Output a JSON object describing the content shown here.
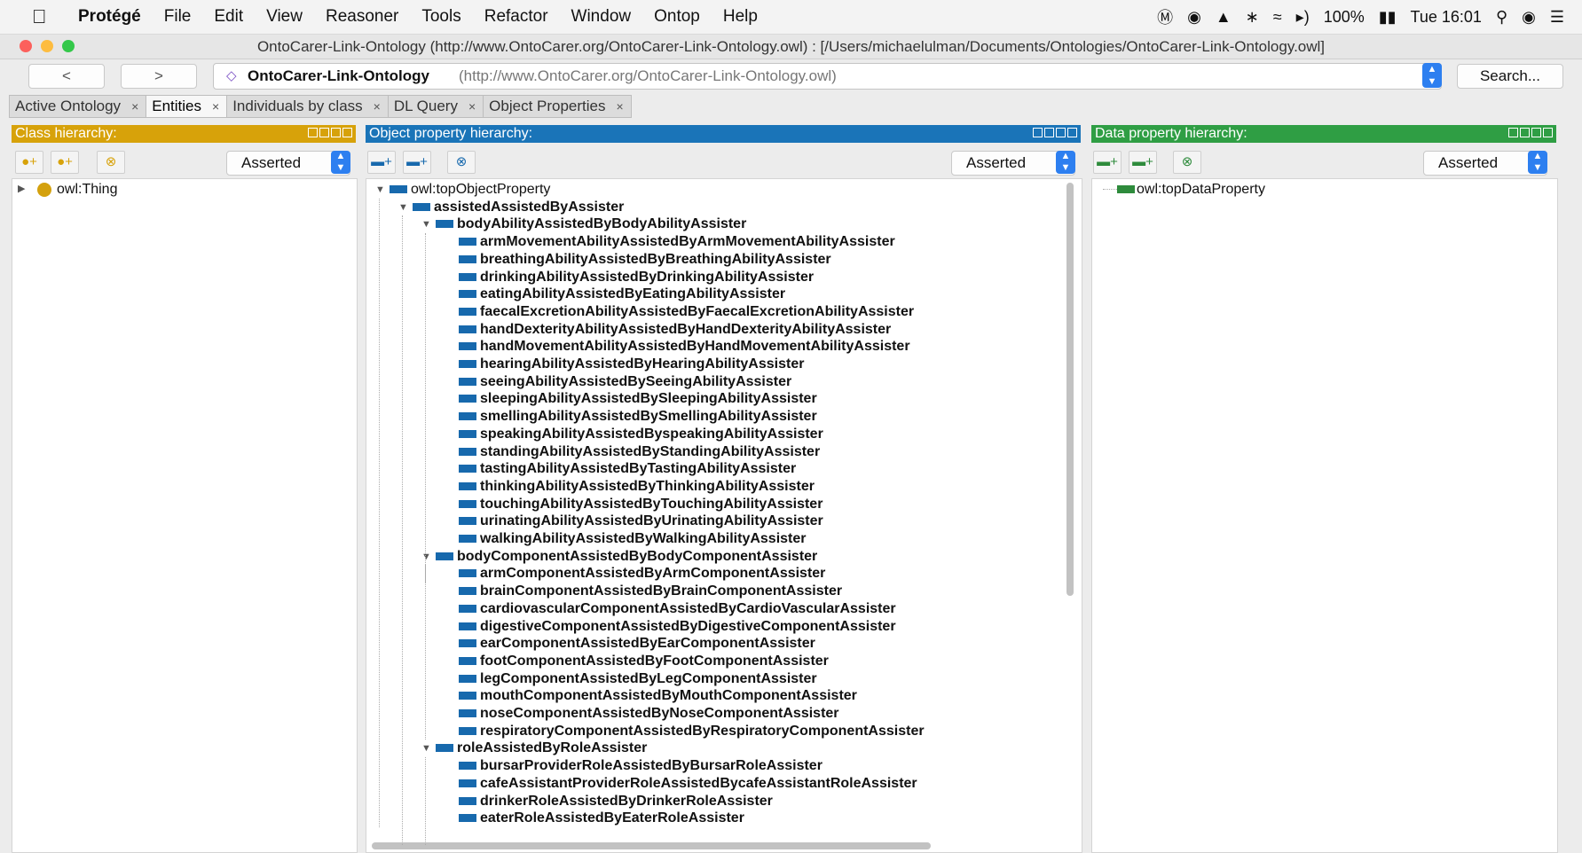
{
  "menubar": {
    "apple_icon": "apple-logo",
    "app_name": "Protégé",
    "items": [
      "File",
      "Edit",
      "View",
      "Reasoner",
      "Tools",
      "Refactor",
      "Window",
      "Ontop",
      "Help"
    ],
    "battery": "100%",
    "clock": "Tue 16:01"
  },
  "window": {
    "title": "OntoCarer-Link-Ontology (http://www.OntoCarer.org/OntoCarer-Link-Ontology.owl)  : [/Users/michaelulman/Documents/Ontologies/OntoCarer-Link-Ontology.owl]"
  },
  "nav": {
    "back": "<",
    "forward": ">",
    "ontology_name": "OntoCarer-Link-Ontology",
    "ontology_iri": "(http://www.OntoCarer.org/OntoCarer-Link-Ontology.owl)",
    "search": "Search..."
  },
  "tabs": [
    {
      "label": "Active Ontology",
      "active": false
    },
    {
      "label": "Entities",
      "active": true
    },
    {
      "label": "Individuals by class",
      "active": false
    },
    {
      "label": "DL Query",
      "active": false
    },
    {
      "label": "Object Properties",
      "active": false
    }
  ],
  "colors": {
    "class_header": "#d7a20a",
    "object_header": "#1a74b8",
    "data_header": "#2f9e44",
    "object_bar": "#1769ad",
    "data_bar": "#2e8b3c",
    "class_dot": "#d4a10e"
  },
  "class_panel": {
    "header": "Class hierarchy:",
    "mode": "Asserted",
    "root": "owl:Thing"
  },
  "object_panel": {
    "header": "Object property hierarchy:",
    "mode": "Asserted",
    "rows": [
      {
        "label": "owl:topObjectProperty",
        "depth": 0,
        "expanded": true,
        "bold": false
      },
      {
        "label": "assistedAssistedByAssister",
        "depth": 1,
        "expanded": true,
        "bold": true
      },
      {
        "label": "bodyAbilityAssistedByBodyAbilityAssister",
        "depth": 2,
        "expanded": true,
        "bold": true
      },
      {
        "label": "armMovementAbilityAssistedByArmMovementAbilityAssister",
        "depth": 3,
        "bold": true
      },
      {
        "label": "breathingAbilityAssistedByBreathingAbilityAssister",
        "depth": 3,
        "bold": true
      },
      {
        "label": "drinkingAbilityAssistedByDrinkingAbilityAssister",
        "depth": 3,
        "bold": true
      },
      {
        "label": "eatingAbilityAssistedByEatingAbilityAssister",
        "depth": 3,
        "bold": true
      },
      {
        "label": "faecalExcretionAbilityAssistedByFaecalExcretionAbilityAssister",
        "depth": 3,
        "bold": true
      },
      {
        "label": "handDexterityAbilityAssistedByHandDexterityAbilityAssister",
        "depth": 3,
        "bold": true
      },
      {
        "label": "handMovementAbilityAssistedByHandMovementAbilityAssister",
        "depth": 3,
        "bold": true
      },
      {
        "label": "hearingAbilityAssistedByHearingAbilityAssister",
        "depth": 3,
        "bold": true
      },
      {
        "label": "seeingAbilityAssistedBySeeingAbilityAssister",
        "depth": 3,
        "bold": true
      },
      {
        "label": "sleepingAbilityAssistedBySleepingAbilityAssister",
        "depth": 3,
        "bold": true
      },
      {
        "label": "smellingAbilityAssistedBySmellingAbilityAssister",
        "depth": 3,
        "bold": true
      },
      {
        "label": "speakingAbilityAssistedByspeakingAbilityAssister",
        "depth": 3,
        "bold": true
      },
      {
        "label": "standingAbilityAssistedByStandingAbilityAssister",
        "depth": 3,
        "bold": true
      },
      {
        "label": "tastingAbilityAssistedByTastingAbilityAssister",
        "depth": 3,
        "bold": true
      },
      {
        "label": "thinkingAbilityAssistedByThinkingAbilityAssister",
        "depth": 3,
        "bold": true
      },
      {
        "label": "touchingAbilityAssistedByTouchingAbilityAssister",
        "depth": 3,
        "bold": true
      },
      {
        "label": "urinatingAbilityAssistedByUrinatingAbilityAssister",
        "depth": 3,
        "bold": true
      },
      {
        "label": "walkingAbilityAssistedByWalkingAbilityAssister",
        "depth": 3,
        "bold": true
      },
      {
        "label": "bodyComponentAssistedByBodyComponentAssister",
        "depth": 2,
        "expanded": true,
        "bold": true
      },
      {
        "label": "armComponentAssistedByArmComponentAssister",
        "depth": 3,
        "bold": true
      },
      {
        "label": "brainComponentAssistedByBrainComponentAssister",
        "depth": 3,
        "bold": true
      },
      {
        "label": "cardiovascularComponentAssistedByCardioVascularAssister",
        "depth": 3,
        "bold": true
      },
      {
        "label": "digestiveComponentAssistedByDigestiveComponentAssister",
        "depth": 3,
        "bold": true
      },
      {
        "label": "earComponentAssistedByEarComponentAssister",
        "depth": 3,
        "bold": true
      },
      {
        "label": "footComponentAssistedByFootComponentAssister",
        "depth": 3,
        "bold": true
      },
      {
        "label": "legComponentAssistedByLegComponentAssister",
        "depth": 3,
        "bold": true
      },
      {
        "label": "mouthComponentAssistedByMouthComponentAssister",
        "depth": 3,
        "bold": true
      },
      {
        "label": "noseComponentAssistedByNoseComponentAssister",
        "depth": 3,
        "bold": true
      },
      {
        "label": "respiratoryComponentAssistedByRespiratoryComponentAssister",
        "depth": 3,
        "bold": true
      },
      {
        "label": "roleAssistedByRoleAssister",
        "depth": 2,
        "expanded": true,
        "bold": true
      },
      {
        "label": "bursarProviderRoleAssistedByBursarRoleAssister",
        "depth": 3,
        "bold": true
      },
      {
        "label": "cafeAssistantProviderRoleAssistedBycafeAssistantRoleAssister",
        "depth": 3,
        "bold": true
      },
      {
        "label": "drinkerRoleAssistedByDrinkerRoleAssister",
        "depth": 3,
        "bold": true
      },
      {
        "label": "eaterRoleAssistedByEaterRoleAssister",
        "depth": 3,
        "bold": true
      }
    ]
  },
  "data_panel": {
    "header": "Data property hierarchy:",
    "mode": "Asserted",
    "root": "owl:topDataProperty"
  }
}
